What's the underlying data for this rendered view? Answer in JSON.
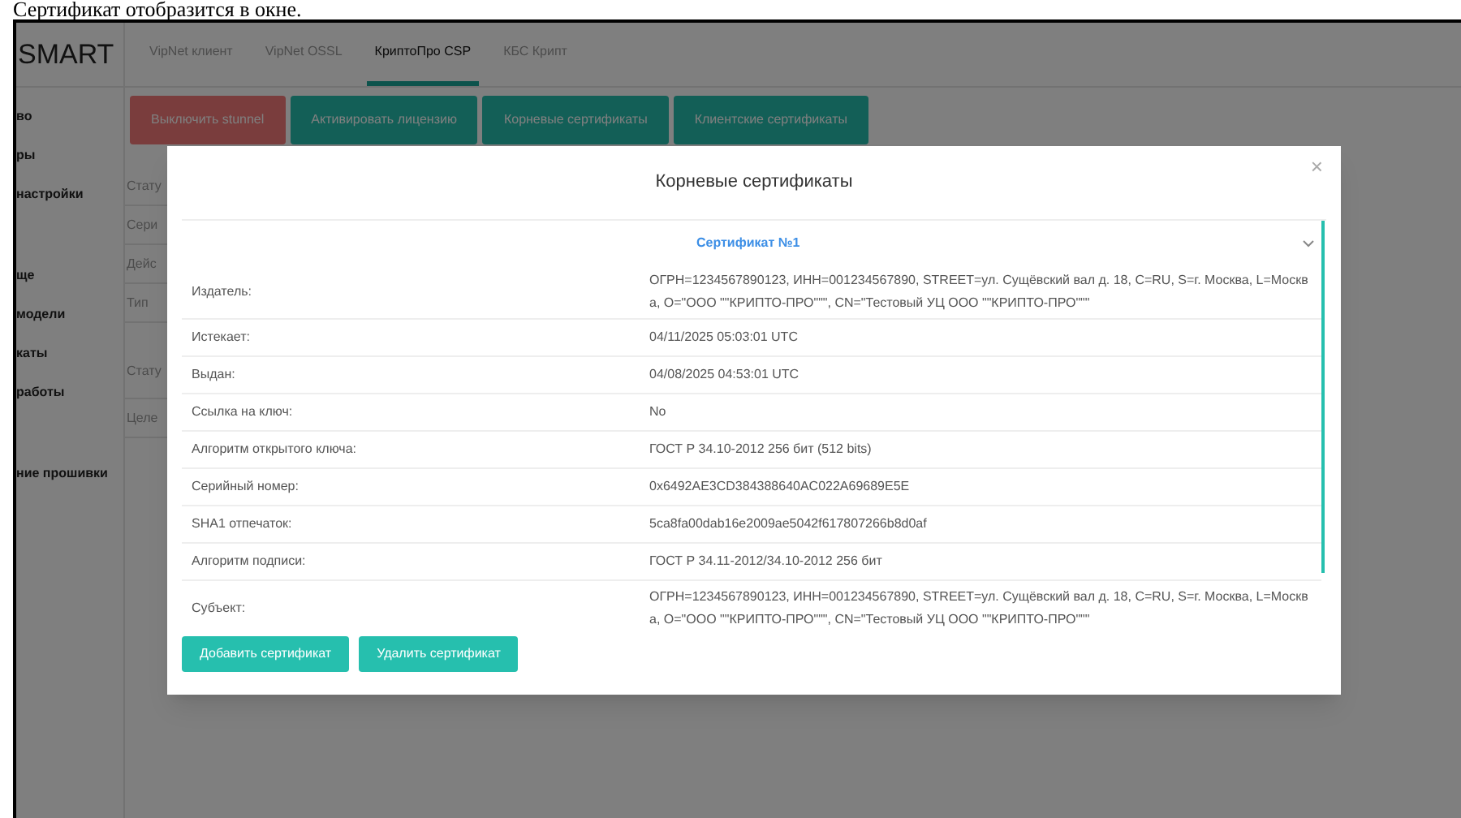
{
  "caption": "Сертификат отобразится в окне.",
  "logo": "SMART",
  "tabs": [
    {
      "label": "VipNet клиент",
      "selected": false
    },
    {
      "label": "VipNet OSSL",
      "selected": false
    },
    {
      "label": "КриптоПро CSP",
      "selected": true
    },
    {
      "label": "КБС Крипт",
      "selected": false
    }
  ],
  "actions": [
    {
      "label": "Выключить stunnel",
      "kind": "danger"
    },
    {
      "label": "Активировать лицензию",
      "kind": "primary"
    },
    {
      "label": "Корневые сертификаты",
      "kind": "primary"
    },
    {
      "label": "Клиентские сертификаты",
      "kind": "primary"
    }
  ],
  "sidebar": {
    "groups": [
      [
        "во",
        "ры",
        "настройки"
      ],
      [
        "ще",
        "модели",
        "каты",
        "работы"
      ],
      [
        "ние прошивки"
      ]
    ]
  },
  "background_rows": [
    {
      "label": "Стату"
    },
    {
      "label": "Сери"
    },
    {
      "label": "Дейс"
    },
    {
      "label": "Тип"
    },
    {
      "label": "Стату"
    },
    {
      "label": "Целе"
    }
  ],
  "modal": {
    "title": "Корневые сертификаты",
    "close": "×",
    "accordion": {
      "title": "Сертификат №1",
      "expanded": true,
      "rows": [
        {
          "label": "Издатель:",
          "value": "ОГРН=1234567890123, ИНН=001234567890, STREET=ул. Сущёвский вал д. 18, C=RU, S=г. Москва, L=Москва, O=\"ООО \"\"КРИПТО-ПРО\"\"\", CN=\"Тестовый УЦ ООО \"\"КРИПТО-ПРО\"\"\""
        },
        {
          "label": "Истекает:",
          "value": "04/11/2025 05:03:01 UTC"
        },
        {
          "label": "Выдан:",
          "value": "04/08/2025 04:53:01 UTC"
        },
        {
          "label": "Ссылка на ключ:",
          "value": "No"
        },
        {
          "label": "Алгоритм открытого ключа:",
          "value": "ГОСТ Р 34.10-2012 256 бит (512 bits)"
        },
        {
          "label": "Серийный номер:",
          "value": "0x6492AE3CD384388640AC022A69689E5E"
        },
        {
          "label": "SHA1 отпечаток:",
          "value": "5ca8fa00dab16e2009ae5042f617807266b8d0af"
        },
        {
          "label": "Алгоритм подписи:",
          "value": "ГОСТ Р 34.11-2012/34.10-2012 256 бит"
        },
        {
          "label": "Субъект:",
          "value": "ОГРН=1234567890123, ИНН=001234567890, STREET=ул. Сущёвский вал д. 18, C=RU, S=г. Москва, L=Москва, O=\"ООО \"\"КРИПТО-ПРО\"\"\", CN=\"Тестовый УЦ ООО \"\"КРИПТО-ПРО\"\"\""
        }
      ]
    },
    "buttons": [
      "Добавить сертификат",
      "Удалить сертификат"
    ]
  }
}
